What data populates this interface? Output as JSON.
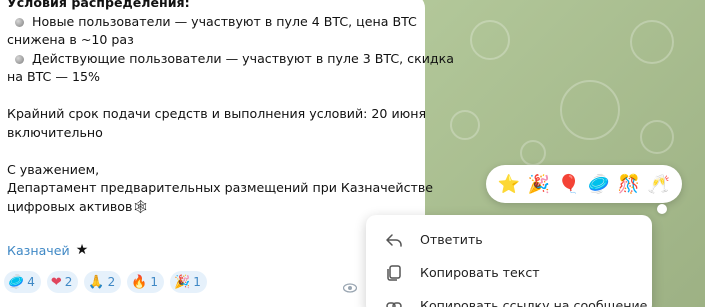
{
  "message": {
    "heading": "Условия распределения:",
    "bullets": [
      [
        "Новые пользователи — участвуют в пуле 4 BTC, цена BTC",
        "снижена в ~10 раз"
      ],
      [
        "Действующие пользователи — участвуют в пуле 3 BTC, скидка",
        "на BTC — 15%"
      ]
    ],
    "deadline": [
      "Крайний срок подачи средств и выполнения условий: 20 июня",
      "включительно"
    ],
    "closing": [
      "С уважением,",
      "Департамент предварительных размещений при Казначействе",
      "цифровых активов"
    ],
    "signature_emoji": "🕸"
  },
  "author": {
    "name": "Казначей",
    "badge": "★"
  },
  "reactions": [
    {
      "emoji": "🥏",
      "count": "4"
    },
    {
      "emoji": "❤",
      "count": "2"
    },
    {
      "emoji": "🙏",
      "count": "2"
    },
    {
      "emoji": "🔥",
      "count": "1"
    },
    {
      "emoji": "🎉",
      "count": "1"
    }
  ],
  "views_icon": "eye-icon",
  "reaction_bar": [
    "⭐",
    "🎉",
    "🎈",
    "🥏",
    "🎊",
    "🥂"
  ],
  "context_menu": {
    "reply": "Ответить",
    "copy_text": "Копировать текст",
    "copy_link": "Копировать ссылку на сообщение"
  },
  "colors": {
    "accent": "#3f88c5",
    "reaction_bg": "#e6f1fb",
    "wallpaper": "#a9bf8f"
  }
}
